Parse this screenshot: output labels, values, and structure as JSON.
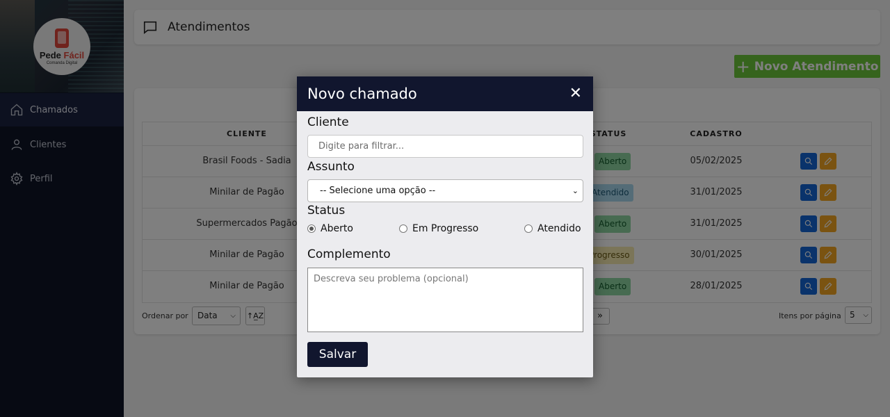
{
  "brand": {
    "name_part1": "Pede ",
    "name_part2": "Fácil",
    "tagline": "Comanda Digital"
  },
  "sidebar": {
    "items": [
      {
        "label": "Chamados",
        "icon": "home-icon"
      },
      {
        "label": "Clientes",
        "icon": "user-icon"
      },
      {
        "label": "Perfil",
        "icon": "gear-icon"
      }
    ]
  },
  "header": {
    "title": "Atendimentos",
    "icon": "chat-icon"
  },
  "actions": {
    "new_label": "Novo Atendimento"
  },
  "table": {
    "columns": {
      "cliente": "CLIENTE",
      "status": "STATUS",
      "cadastro": "CADASTRO"
    },
    "rows": [
      {
        "cliente": "Brasil Foods - Sadia",
        "status": "Aberto",
        "cadastro": "05/02/2025"
      },
      {
        "cliente": "Minilar de Pagão",
        "status": "Atendido",
        "cadastro": "31/01/2025"
      },
      {
        "cliente": "Supermercados Pagão",
        "status": "Aberto",
        "cadastro": "31/01/2025"
      },
      {
        "cliente": "Minilar de Pagão",
        "status": "Progresso",
        "cadastro": "30/01/2025"
      },
      {
        "cliente": "Minilar de Pagão",
        "status": "Aberto",
        "cadastro": "28/01/2025"
      }
    ]
  },
  "footer": {
    "sort_label": "Ordenar por",
    "sort_value": "Data",
    "sort_dir": "↑A̲Z",
    "next_label": "»",
    "ipp_label": "Itens por página",
    "ipp_value": "5"
  },
  "modal": {
    "title": "Novo chamado",
    "close": "✕",
    "cliente_label": "Cliente",
    "cliente_placeholder": "Digite para filtrar...",
    "assunto_label": "Assunto",
    "assunto_value": "-- Selecione uma opção --",
    "status_label": "Status",
    "status_options": [
      "Aberto",
      "Em Progresso",
      "Atendido"
    ],
    "status_selected": "Aberto",
    "complemento_label": "Complemento",
    "complemento_placeholder": "Descreva seu problema (opcional)",
    "save_label": "Salvar"
  },
  "colors": {
    "sidebar": "#0e1427",
    "modal_header": "#11162e",
    "new_button": "#6cc93a",
    "view_button": "#1466d6",
    "edit_button": "#f5a623"
  }
}
